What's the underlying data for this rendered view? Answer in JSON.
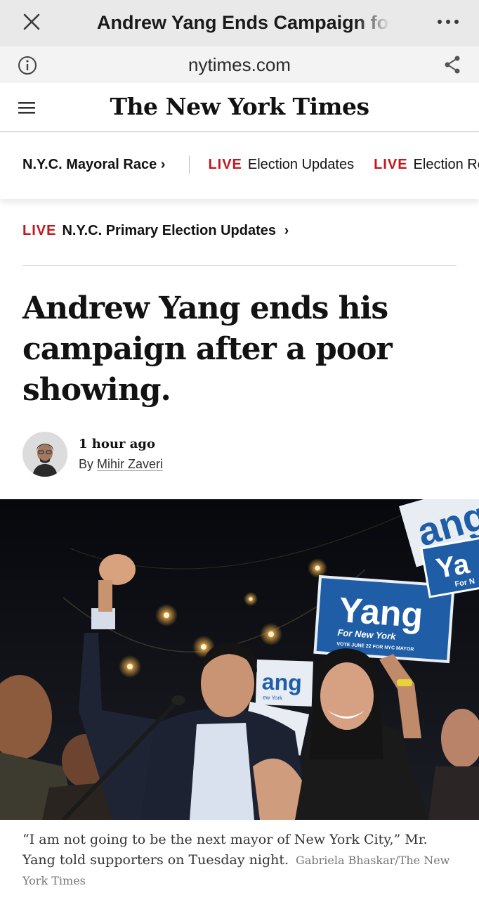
{
  "browser": {
    "title": "Andrew Yang Ends Campaign for",
    "url": "nytimes.com"
  },
  "header": {
    "masthead": "The New York Times"
  },
  "section_nav": {
    "items": [
      {
        "live": "",
        "label": "N.Y.C. Mayoral Race",
        "chevron": "›"
      },
      {
        "live": "LIVE",
        "label": "Election Updates"
      },
      {
        "live": "LIVE",
        "label": "Election Res"
      }
    ]
  },
  "live_banner": {
    "live": "LIVE",
    "label": "N.Y.C. Primary Election Updates",
    "chevron": "›"
  },
  "article": {
    "headline": "Andrew Yang ends his campaign after a poor showing.",
    "timestamp": "1 hour ago",
    "byline_prefix": "By",
    "author": "Mihir Zaveri",
    "photo_signs": [
      "Yang",
      "For New York",
      "VOTE JUNE 22 FOR NYC MAYOR",
      "ang",
      "ew York",
      "ang",
      "Ya",
      "For N"
    ],
    "caption": "“I am not going to be the next mayor of New York City,” Mr. Yang told supporters on Tuesday night.",
    "credit": "Gabriela Bhaskar/The New York Times"
  },
  "colors": {
    "live_red": "#c4161c",
    "sign_blue": "#1f5da6",
    "chrome_gray": "#e9e9e9"
  },
  "icons": [
    "close-icon",
    "more-icon",
    "info-icon",
    "share-icon",
    "hamburger-menu-icon",
    "chevron-right-icon"
  ]
}
